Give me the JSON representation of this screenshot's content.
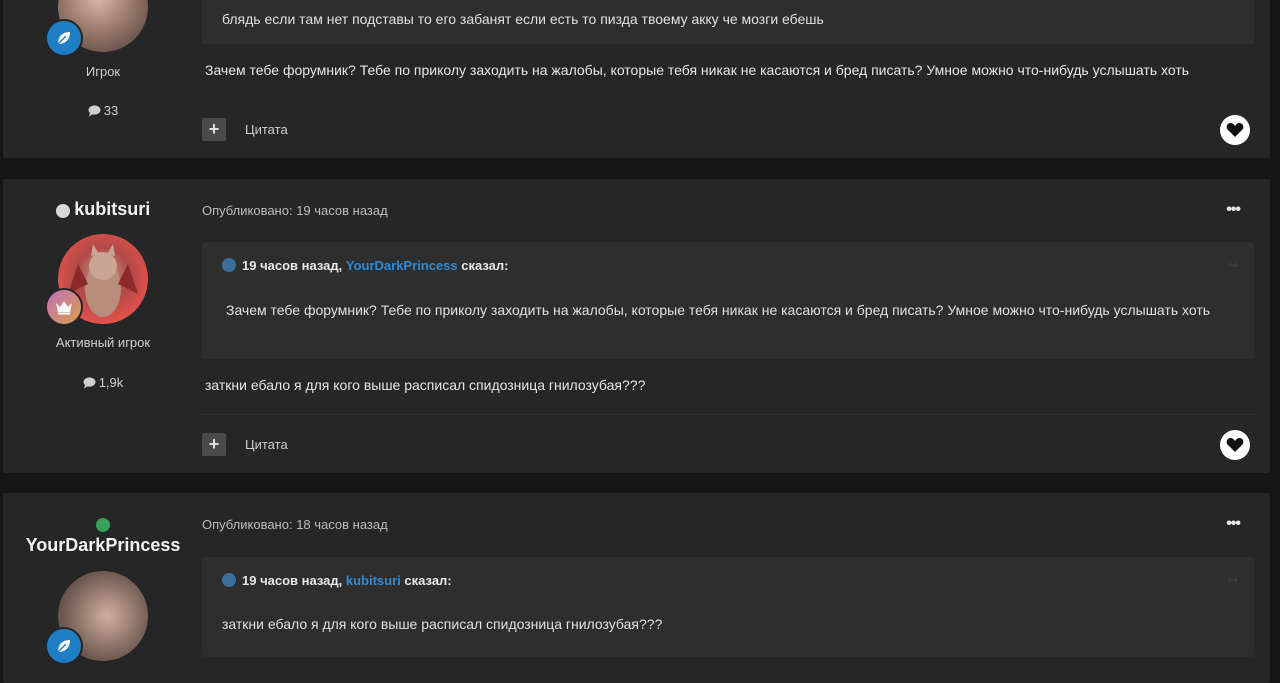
{
  "colors": {
    "page_bg": "#161616",
    "post_bg": "#262626",
    "quote_bg": "#2e2e2e",
    "link_blue": "#2e8bd6",
    "online_green": "#3aa05a",
    "offline_gray": "#d9d9d9"
  },
  "posts": [
    {
      "group": "Игрок",
      "post_count": "33",
      "quote_tail": "блядь если там нет подставы то его забанят если есть то пизда твоему акку че мозги ебешь",
      "body": "Зачем тебе форумник? Тебе по приколу заходить на жалобы, которые тебя никак не касаются и бред писать? Умное можно что-нибудь услышать хоть",
      "quote_label": "Цитата",
      "badge_icon": "leaf-icon"
    },
    {
      "author": "kubitsuri",
      "group": "Активный игрок",
      "post_count": "1,9k",
      "meta": "Опубликовано: 19 часов назад",
      "quote": {
        "time": "19 часов назад,",
        "user": "YourDarkPrincess",
        "said": "сказал:",
        "text": "Зачем тебе форумник? Тебе по приколу заходить на жалобы, которые тебя никак не касаются и бред писать? Умное можно что-нибудь услышать хоть"
      },
      "body": "заткни ебало я для кого выше расписал спидозница гнилозубая???",
      "quote_label": "Цитата",
      "badge_icon": "crown-icon"
    },
    {
      "author": "YourDarkPrincess",
      "meta": "Опубликовано: 18 часов назад",
      "quote": {
        "time": "19 часов назад,",
        "user": "kubitsuri",
        "said": "сказал:",
        "text": "заткни ебало я для кого выше расписал спидозница гнилозубая???"
      },
      "badge_icon": "leaf-icon"
    }
  ]
}
